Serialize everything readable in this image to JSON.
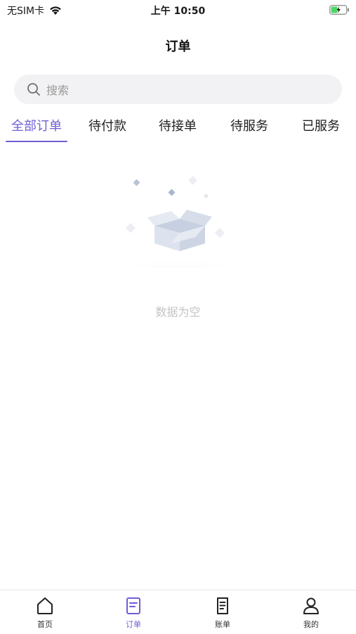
{
  "status_bar": {
    "carrier": "无SIM卡",
    "time": "上午 10:50"
  },
  "header": {
    "title": "订单"
  },
  "search": {
    "placeholder": "搜索"
  },
  "tabs": [
    {
      "label": "全部订单",
      "active": true
    },
    {
      "label": "待付款",
      "active": false
    },
    {
      "label": "待接单",
      "active": false
    },
    {
      "label": "待服务",
      "active": false
    },
    {
      "label": "已服务",
      "active": false
    }
  ],
  "empty_state": {
    "text": "数据为空"
  },
  "bottom_nav": [
    {
      "label": "首页",
      "icon": "home-icon",
      "active": false
    },
    {
      "label": "订单",
      "icon": "order-icon",
      "active": true
    },
    {
      "label": "账单",
      "icon": "bill-icon",
      "active": false
    },
    {
      "label": "我的",
      "icon": "profile-icon",
      "active": false
    }
  ],
  "colors": {
    "accent": "#6e5fd6",
    "empty_text": "#c4c4c8",
    "search_bg": "#f2f2f4"
  }
}
